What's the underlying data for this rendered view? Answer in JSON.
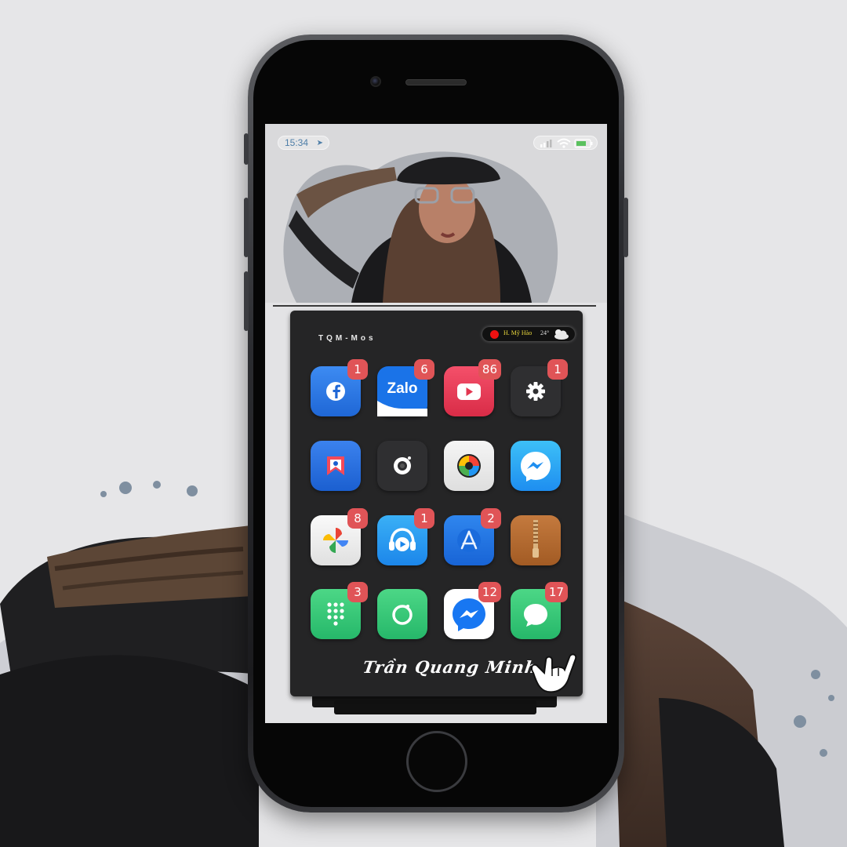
{
  "status_bar": {
    "time": "15:34"
  },
  "widget": {
    "title": "TQM-Mos",
    "location": "H. Mỹ Hào",
    "temperature": "24°"
  },
  "apps": [
    {
      "icon": "facebook-icon",
      "badge": "1"
    },
    {
      "icon": "zalo-icon",
      "label": "Zalo",
      "badge": "6"
    },
    {
      "icon": "youtube-icon",
      "badge": "86"
    },
    {
      "icon": "settings-gear-icon",
      "badge": "1"
    },
    {
      "icon": "bookmark-app-icon",
      "badge": ""
    },
    {
      "icon": "camera-icon",
      "badge": ""
    },
    {
      "icon": "photo-lens-icon",
      "badge": ""
    },
    {
      "icon": "messenger-icon",
      "badge": ""
    },
    {
      "icon": "google-photos-icon",
      "badge": "8"
    },
    {
      "icon": "music-player-icon",
      "badge": "1"
    },
    {
      "icon": "app-store-icon",
      "badge": "2"
    },
    {
      "icon": "zip-archive-icon",
      "badge": ""
    },
    {
      "icon": "dialer-icon",
      "badge": "3"
    },
    {
      "icon": "camera-ring-icon",
      "badge": ""
    },
    {
      "icon": "messenger-white-icon",
      "badge": "12"
    },
    {
      "icon": "messages-icon",
      "badge": "17"
    }
  ],
  "signature": "Trần Quang Minh"
}
